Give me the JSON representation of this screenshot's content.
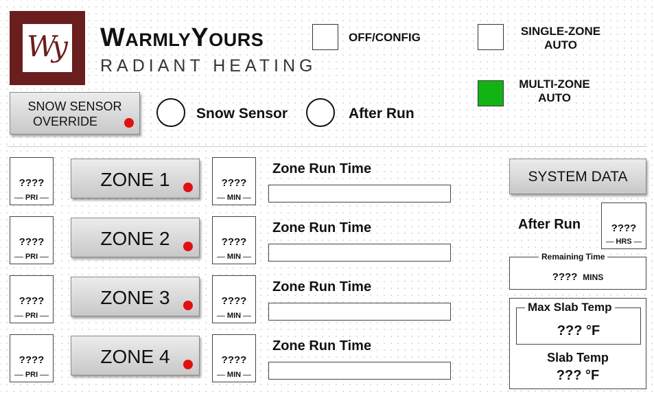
{
  "brand": {
    "logo_monogram": "Wy",
    "title": "WarmlyYours",
    "subtitle": "RADIANT HEATING",
    "colors": {
      "logo": "#6b1e1e"
    }
  },
  "modes": {
    "off_config": {
      "label": "OFF/CONFIG",
      "active": false
    },
    "single_zone": {
      "label_line1": "SINGLE-ZONE",
      "label_line2": "AUTO",
      "active": false
    },
    "multi_zone": {
      "label_line1": "MULTI-ZONE",
      "label_line2": "AUTO",
      "active": true,
      "active_color": "#14b314"
    }
  },
  "snow_override": {
    "label_line1": "SNOW SENSOR",
    "label_line2": "OVERRIDE",
    "indicator_color": "#e01010"
  },
  "status": {
    "snow_sensor": "Snow Sensor",
    "after_run": "After Run"
  },
  "zones": [
    {
      "name": "ZONE 1",
      "pri": "????",
      "pri_caption": "PRI",
      "min": "????",
      "min_caption": "MIN",
      "runtime_label": "Zone Run Time",
      "runtime_value": ""
    },
    {
      "name": "ZONE 2",
      "pri": "????",
      "pri_caption": "PRI",
      "min": "????",
      "min_caption": "MIN",
      "runtime_label": "Zone Run Time",
      "runtime_value": ""
    },
    {
      "name": "ZONE 3",
      "pri": "????",
      "pri_caption": "PRI",
      "min": "????",
      "min_caption": "MIN",
      "runtime_label": "Zone Run Time",
      "runtime_value": ""
    },
    {
      "name": "ZONE 4",
      "pri": "????",
      "pri_caption": "PRI",
      "min": "????",
      "min_caption": "MIN",
      "runtime_label": "Zone Run Time",
      "runtime_value": ""
    }
  ],
  "system": {
    "system_data_label": "SYSTEM DATA",
    "after_run_label": "After Run",
    "after_run_hrs": "????",
    "after_run_hrs_caption": "HRS",
    "remaining_time_label": "Remaining Time",
    "remaining_time_value": "????",
    "remaining_time_unit": "MINS",
    "max_slab_label": "Max Slab Temp",
    "max_slab_value": "??? °F",
    "slab_temp_label": "Slab Temp",
    "slab_temp_value": "??? °F"
  }
}
